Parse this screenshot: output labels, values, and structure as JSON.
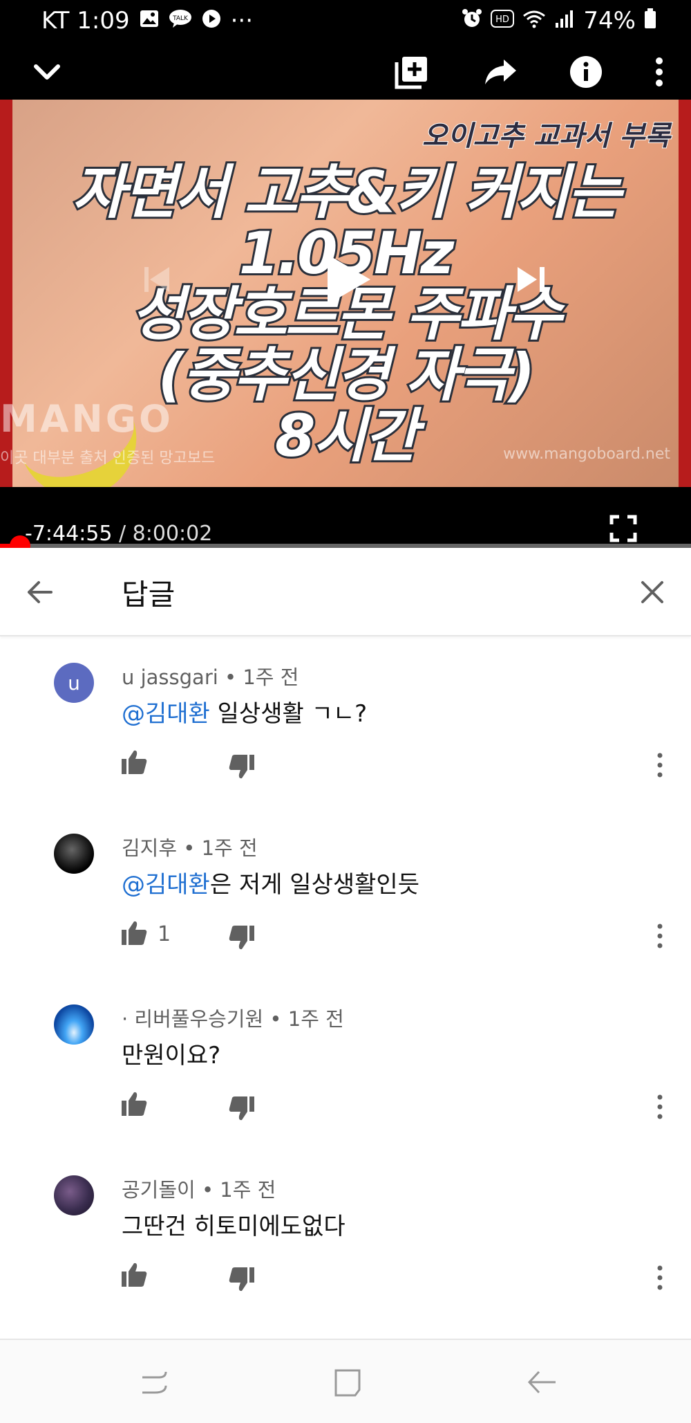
{
  "status": {
    "carrier_time": "KT 1:09",
    "battery": "74%",
    "dots": "···",
    "talk_badge": "TALK",
    "hd_badge": "HD"
  },
  "video": {
    "subtitle": "오이고추 교과서 부록",
    "title_lines": [
      "자면서 고추&키 커지는",
      "1.05Hz",
      "성장호르몬 주파수",
      "(중추신경 자극)",
      "8시간"
    ],
    "brand": "MANGO",
    "watermark_left": "이곳 대부분 출처 인증된 망고보드",
    "watermark_right": "www.mangoboard.net",
    "elapsed": "-7:44:55",
    "separator": " / ",
    "duration": "8:00:02",
    "progress": 0.02
  },
  "replies_header": {
    "title": "답글"
  },
  "comments": [
    {
      "author": "u jassgari",
      "time": "1주 전",
      "mention": "@김대환",
      "text": " 일상생활 ㄱㄴ?",
      "likes": "",
      "avatar_letter": "u",
      "avatar_color": "#5c6bc0"
    },
    {
      "author": "김지후",
      "time": "1주 전",
      "mention": "@김대환",
      "text": "은 저게 일상생활인듯",
      "likes": "1",
      "avatar_letter": "",
      "avatar_color": "#111111"
    },
    {
      "author": "· 리버풀우승기원",
      "time": "1주 전",
      "mention": "",
      "text": "만원이요?",
      "likes": "",
      "avatar_letter": "",
      "avatar_color": "#1565c0"
    },
    {
      "author": "공기돌이",
      "time": "1주 전",
      "mention": "",
      "text": "그딴건 히토미에도없다",
      "likes": "",
      "avatar_letter": "",
      "avatar_color": "#3a2d4f"
    }
  ],
  "meta_separator": " • ",
  "colors": {
    "mention": "#1f6fd1",
    "progress": "#ff0000",
    "icon_gray": "#606060"
  }
}
